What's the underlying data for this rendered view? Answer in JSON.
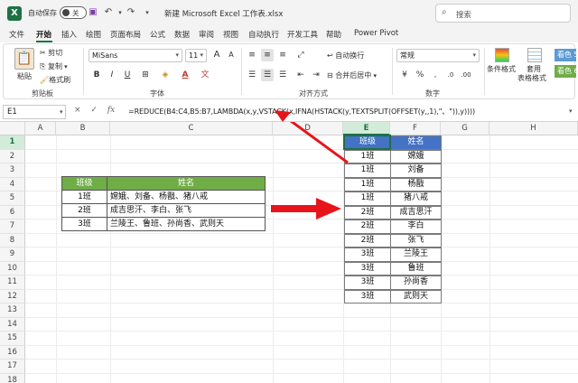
{
  "titlebar": {
    "app_icon": "X",
    "autosave_label": "自动保存",
    "autosave_state": "关",
    "title": "新建 Microsoft Excel 工作表.xlsx",
    "search_placeholder": "搜索"
  },
  "menu": [
    "文件",
    "开始",
    "插入",
    "绘图",
    "页面布局",
    "公式",
    "数据",
    "审阅",
    "视图",
    "自动执行",
    "开发工具",
    "帮助",
    "Power Pivot"
  ],
  "active_menu": "开始",
  "ribbon": {
    "clipboard": {
      "paste": "粘贴",
      "cut": "剪切",
      "copy": "复制",
      "format_painter": "格式刷",
      "label": "剪贴板"
    },
    "font": {
      "name": "MiSans",
      "size": "11",
      "label": "字体"
    },
    "alignment": {
      "wrap": "自动换行",
      "merge": "合并后居中",
      "label": "对齐方式"
    },
    "number": {
      "format": "常规",
      "label": "数字"
    },
    "styles": {
      "conditional": "条件格式",
      "table_format_1": "套用",
      "table_format_2": "表格格式",
      "style1": "看色 5",
      "style2": "看色 6"
    }
  },
  "formula_bar": {
    "name_box": "E1",
    "cancel_icon": "×",
    "enter_icon": "✓",
    "fx_label": "fx",
    "formula": "=REDUCE(B4:C4,B5:B7,LAMBDA(x,y,VSTACK(x,IFNA(HSTACK(y,TEXTSPLIT(OFFSET(y,,1),\"、\")),y))))"
  },
  "columns": [
    "A",
    "B",
    "C",
    "D",
    "E",
    "F",
    "G",
    "H"
  ],
  "selected_column": "E",
  "rows": [
    "1",
    "2",
    "3",
    "4",
    "5",
    "6",
    "7",
    "8",
    "9",
    "10",
    "11",
    "12",
    "13",
    "14",
    "15",
    "16",
    "17",
    "18"
  ],
  "selected_row": "1",
  "left_table": {
    "headers": [
      "班级",
      "姓名"
    ],
    "rows": [
      [
        "1班",
        "嫦娥、刘备、杨戬、猪八戒"
      ],
      [
        "2班",
        "成吉思汗、李白、张飞"
      ],
      [
        "3班",
        "兰陵王、鲁班、孙尚香、武则天"
      ]
    ]
  },
  "right_table": {
    "headers": [
      "班级",
      "姓名"
    ],
    "rows": [
      [
        "1班",
        "嫦娥"
      ],
      [
        "1班",
        "刘备"
      ],
      [
        "1班",
        "杨戬"
      ],
      [
        "1班",
        "猪八戒"
      ],
      [
        "2班",
        "成吉思汗"
      ],
      [
        "2班",
        "李白"
      ],
      [
        "2班",
        "张飞"
      ],
      [
        "3班",
        "兰陵王"
      ],
      [
        "3班",
        "鲁班"
      ],
      [
        "3班",
        "孙尚香"
      ],
      [
        "3班",
        "武则天"
      ]
    ]
  },
  "colors": {
    "header_green": "#70ad47",
    "header_blue": "#4472c4",
    "arrow_red": "#e8141b",
    "excel_green": "#1e7145"
  }
}
